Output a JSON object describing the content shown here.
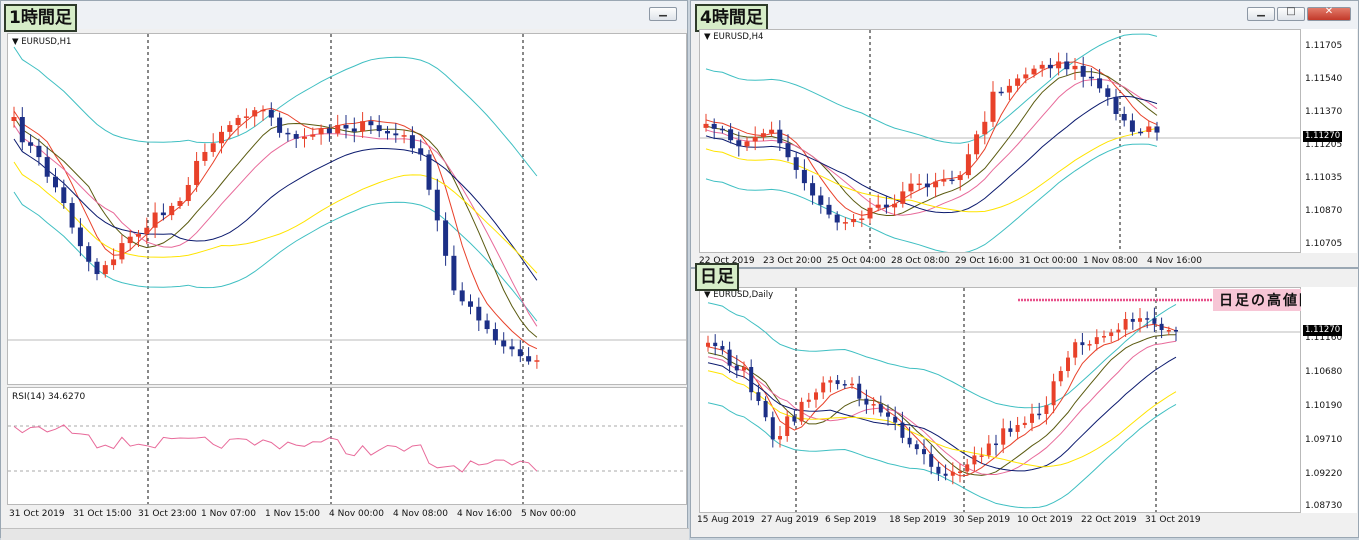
{
  "colors": {
    "bull": "#e8412a",
    "bear": "#1c2f86",
    "bb": "#3fbfc2",
    "ma_fast": "#e8412a",
    "ma_pink": "#e86a9a",
    "ma_olive": "#5a5a10",
    "ma_navy": "#0b1a6e",
    "ma_yellow": "#ffe400",
    "rsi": "#e86a9a",
    "highzone": "#e8508a"
  },
  "h1": {
    "tag": "1時間足",
    "symbol": "EURUSD,H1",
    "rsi_label": "RSI(14) 34.6270",
    "time_labels": [
      "31 Oct 2019",
      "31 Oct 15:00",
      "31 Oct 23:00",
      "1 Nov 07:00",
      "1 Nov 15:00",
      "4 Nov 00:00",
      "4 Nov 08:00",
      "4 Nov 16:00",
      "5 Nov 00:00"
    ]
  },
  "h4": {
    "tag": "4時間足",
    "symbol": "EURUSD,H4",
    "price_labels": [
      "1.11705",
      "1.11540",
      "1.11370",
      "1.11205",
      "1.11035",
      "1.10870",
      "1.10705"
    ],
    "current_price": "1.11270",
    "time_labels": [
      "22 Oct 2019",
      "23 Oct 20:00",
      "25 Oct 04:00",
      "28 Oct 08:00",
      "29 Oct 16:00",
      "31 Oct 00:00",
      "1 Nov 08:00",
      "4 Nov 16:00"
    ]
  },
  "daily": {
    "tag": "日足",
    "symbol": "EURUSD,Daily",
    "note": "日足の高値圏",
    "price_labels": [
      "1.11160",
      "1.10680",
      "1.10190",
      "1.09710",
      "1.09220",
      "1.08730"
    ],
    "current_price": "1.11270",
    "time_labels": [
      "15 Aug 2019",
      "27 Aug 2019",
      "6 Sep 2019",
      "18 Sep 2019",
      "30 Sep 2019",
      "10 Oct 2019",
      "22 Oct 2019",
      "31 Oct 2019"
    ]
  }
}
